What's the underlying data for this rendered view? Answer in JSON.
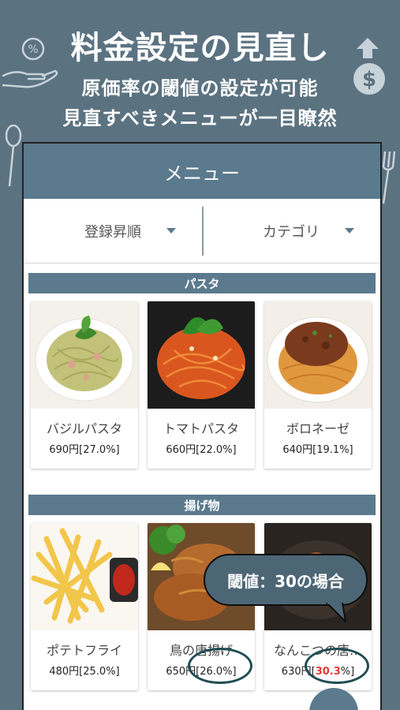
{
  "banner": {
    "headline": "料金設定の見直し",
    "subline1": "原価率の閾値の設定が可能",
    "subline2": "見直すべきメニューが一目瞭然"
  },
  "appbar": {
    "title": "メニュー"
  },
  "filters": {
    "sort_label": "登録昇順",
    "category_label": "カテゴリ"
  },
  "sections": [
    {
      "title": "パスタ",
      "items": [
        {
          "name": "バジルパスタ",
          "price": "690円[27.0%]"
        },
        {
          "name": "トマトパスタ",
          "price": "660円[22.0%]"
        },
        {
          "name": "ボロネーゼ",
          "price": "640円[19.1%]"
        }
      ]
    },
    {
      "title": "揚げ物",
      "items": [
        {
          "name": "ポテトフライ",
          "price": "480円[25.0%]"
        },
        {
          "name": "鳥の唐揚げ",
          "price": "650円[26.0%]"
        },
        {
          "name": "なんこつの唐…",
          "price_prefix": "630円[",
          "price_highlight": "30.3",
          "price_suffix": "%]"
        }
      ]
    }
  ],
  "callout": {
    "text": "閾値：30の場合"
  },
  "colors": {
    "accent": "#5b7a8d",
    "highlight": "#e53935",
    "background": "#5b7281"
  },
  "icons": [
    "hand-money-icon",
    "dollar-up-icon",
    "spoon-icon",
    "fork-icon",
    "caret-down-icon"
  ]
}
